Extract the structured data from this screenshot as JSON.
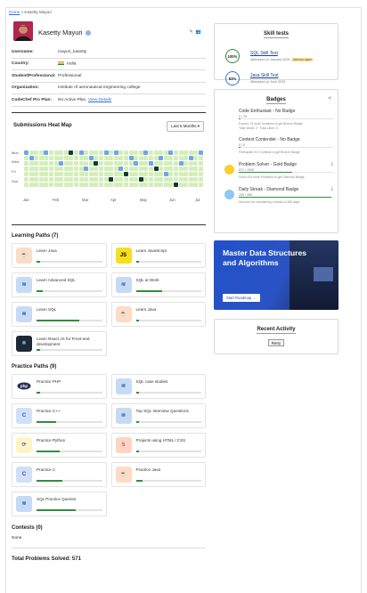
{
  "breadcrumb": {
    "home": "Home",
    "sep": " » ",
    "current": "Kasetty Mayuri"
  },
  "profile": {
    "name": "Kasetty Mayuri",
    "rows": [
      {
        "key": "Username:",
        "value": "mayuri_kasetty"
      },
      {
        "key": "Country:",
        "value": "India"
      },
      {
        "key": "Student/Professional:",
        "value": "Professional"
      },
      {
        "key": "Organization:",
        "value": "Institute of aeronautical engineering college"
      },
      {
        "key": "CodeChef Pro Plan:",
        "value": "No Active Plan.",
        "link": "View Details"
      }
    ]
  },
  "heatmap": {
    "title": "Submissions Heat Map",
    "period": "Last 6 Months",
    "days": [
      "Mon",
      "Wed",
      "Fri",
      "Sun"
    ],
    "months": [
      "Jan",
      "Feb",
      "Mar",
      "Apr",
      "May",
      "Jun",
      "Jul"
    ]
  },
  "learning": {
    "title": "Learning Paths (7)",
    "items": [
      {
        "label": "Learn Java",
        "icon": "java-icon",
        "progress": 0.05
      },
      {
        "label": "Learn JavaScript",
        "icon": "javascript-icon",
        "progress": 0.05
      },
      {
        "label": "Learn Advanced SQL",
        "icon": "database-icon",
        "progress": 0.1
      },
      {
        "label": "SQL at Work",
        "icon": "database-icon",
        "progress": 0.4
      },
      {
        "label": "Learn SQL",
        "icon": "database-icon",
        "progress": 0.65
      },
      {
        "label": "Learn Java",
        "icon": "java-icon",
        "progress": 0.05
      },
      {
        "label": "Learn React JS for Front-end development",
        "icon": "react-icon",
        "progress": 0.05
      }
    ]
  },
  "practice": {
    "title": "Practice Paths (9)",
    "items": [
      {
        "label": "Practice PHP",
        "icon": "php-icon",
        "progress": 0.05
      },
      {
        "label": "SQL case studies",
        "icon": "database-icon",
        "progress": 0.05
      },
      {
        "label": "Practice C++",
        "icon": "cpp-icon",
        "progress": 0.3
      },
      {
        "label": "Top SQL Interview Questions",
        "icon": "database-icon",
        "progress": 0.05
      },
      {
        "label": "Practice Python",
        "icon": "python-icon",
        "progress": 0.35
      },
      {
        "label": "Projects using HTML / CSS",
        "icon": "html-icon",
        "progress": 0.05
      },
      {
        "label": "Practice C",
        "icon": "c-icon",
        "progress": 0.4
      },
      {
        "label": "Practice Java",
        "icon": "java-icon",
        "progress": 0.1
      },
      {
        "label": "SQL Practice Queries",
        "icon": "database-icon",
        "progress": 0.6
      }
    ]
  },
  "contests": {
    "title": "Contests (0)",
    "value": "None"
  },
  "total": {
    "label": "Total Problems Solved: 571"
  },
  "skill_tests": {
    "title": "Skill tests",
    "items": [
      {
        "score": "100%",
        "name": "SQL Skill Test",
        "sub": "Attempted on January 2025",
        "pill": "Attempt again"
      },
      {
        "score": "83%",
        "name": "Java Skill Test",
        "sub": "Attempted on June 2025",
        "pill": ""
      }
    ],
    "view_all": "View skill tests"
  },
  "badges": {
    "title": "Badges",
    "items": [
      {
        "name": "Code Enthusiast - No Badge",
        "progress_text": "0 / 75",
        "desc": "Explore 75 more Solutions to get Bronze Badge",
        "sub": "Total Views: 0 · Total Likes: 0",
        "progress": 0.02,
        "color": "#ffffff"
      },
      {
        "name": "Contest Contender - No Badge",
        "progress_text": "0 / 5",
        "desc": "Participate in 5 Contests to get Bronze Badge",
        "sub": "",
        "progress": 0.02,
        "color": "#ffffff"
      },
      {
        "name": "Problem Solver - Gold Badge",
        "progress_text": "571 / 1000",
        "desc": "Solve 429 more Problems to get Diamond Badge",
        "sub": "",
        "progress": 0.57,
        "color": "#f7cf2e"
      },
      {
        "name": "Daily Streak - Diamond Badge",
        "progress_text": "200 / 365",
        "desc": "Woohoo! for maintaining a streak of 365 days",
        "sub": "",
        "progress": 0.98,
        "color": "#8fc7f2"
      }
    ]
  },
  "promo": {
    "title": "Master Data Structures and Algorithms",
    "button": "Start Roadmap →"
  },
  "recent": {
    "title": "Recent Activity",
    "retry": "Retry"
  },
  "colors": {
    "accent": "#2f8f3a",
    "link": "#2a6fd6",
    "heat_low": "#d4eeb9",
    "heat_mid": "#6ca6e8",
    "heat_high": "#0b3d2c"
  }
}
